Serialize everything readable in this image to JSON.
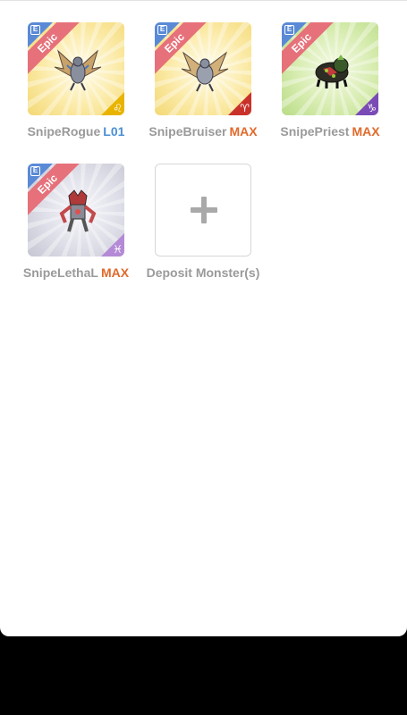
{
  "monsters": [
    {
      "name": "SnipeRogue",
      "level": "L01",
      "level_color": "blue",
      "rarity": "Epic",
      "zodiac": "♌",
      "zodiac_color": "gold",
      "background": "yellow"
    },
    {
      "name": "SnipeBruiser",
      "level": "MAX",
      "level_color": "orange",
      "rarity": "Epic",
      "zodiac": "♈",
      "zodiac_color": "red",
      "background": "yellow"
    },
    {
      "name": "SnipePriest",
      "level": "MAX",
      "level_color": "orange",
      "rarity": "Epic",
      "zodiac": "♑",
      "zodiac_color": "purple",
      "background": "green"
    },
    {
      "name": "SnipeLethaL",
      "level": "MAX",
      "level_color": "orange",
      "rarity": "Epic",
      "zodiac": "♓",
      "zodiac_color": "violet",
      "background": "silver"
    }
  ],
  "deposit": {
    "label": "Deposit Monster(s)"
  },
  "badge_icon": "E",
  "colors": {
    "epic_ribbon": "#e6717a",
    "level_blue": "#4a8fd4",
    "level_orange": "#e06a2c"
  }
}
